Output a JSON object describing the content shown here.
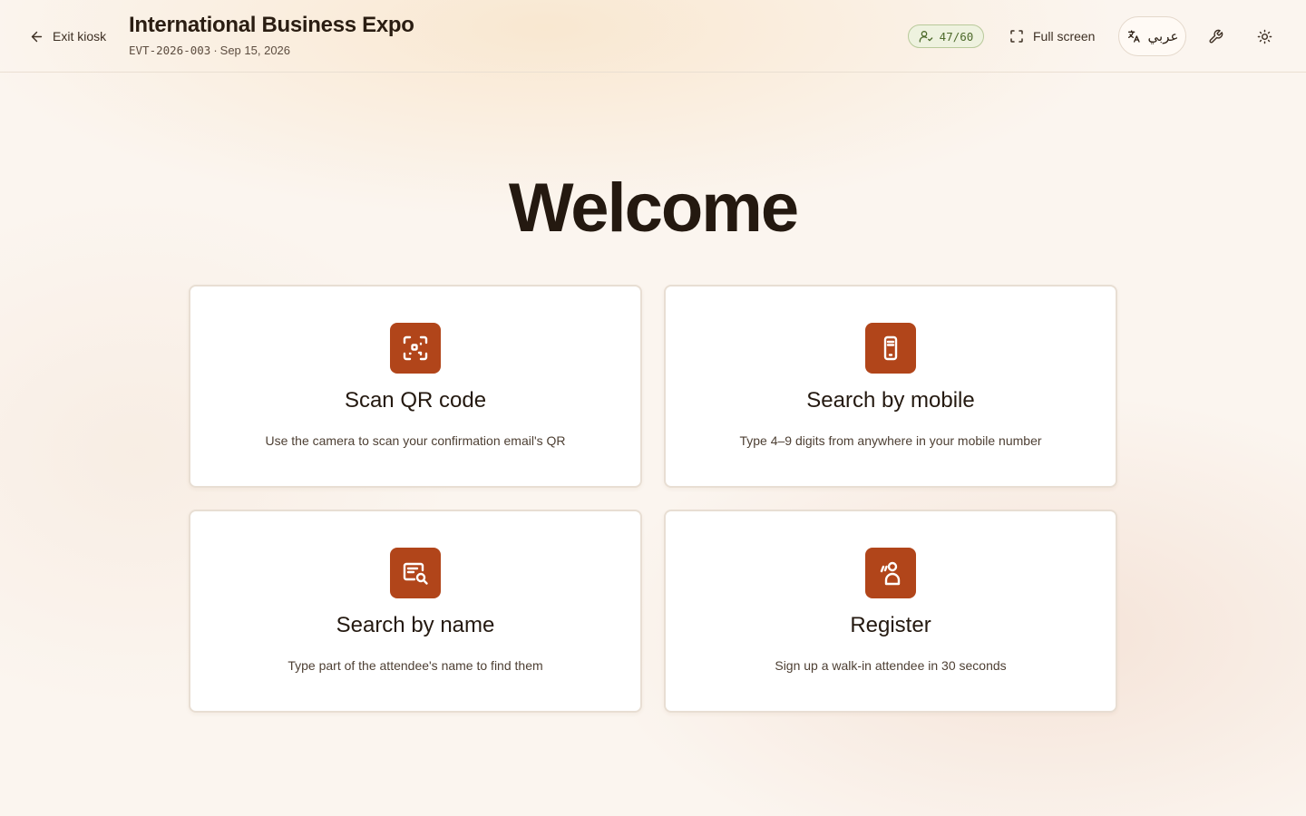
{
  "header": {
    "exit_label": "Exit kiosk",
    "event_title": "International Business Expo",
    "event_code": "EVT-2026-003",
    "separator": "·",
    "event_date": "Sep 15, 2026",
    "checked_in": "47/60",
    "fullscreen_label": "Full screen",
    "language_label": "عربي"
  },
  "main": {
    "welcome": "Welcome",
    "cards": [
      {
        "title": "Scan QR code",
        "description": "Use the camera to scan your confirmation email's QR",
        "icon": "qr-scan-icon"
      },
      {
        "title": "Search by mobile",
        "description": "Type 4–9 digits from anywhere in your mobile number",
        "icon": "smartphone-icon"
      },
      {
        "title": "Search by name",
        "description": "Type part of the attendee's name to find them",
        "icon": "text-search-icon"
      },
      {
        "title": "Register",
        "description": "Sign up a walk-in attendee in 30 seconds",
        "icon": "walk-in-user-icon"
      }
    ]
  },
  "colors": {
    "accent": "#b1451a",
    "badge_text": "#4d6a2b",
    "badge_bg": "#eef2df",
    "background": "#fbf5ef"
  }
}
